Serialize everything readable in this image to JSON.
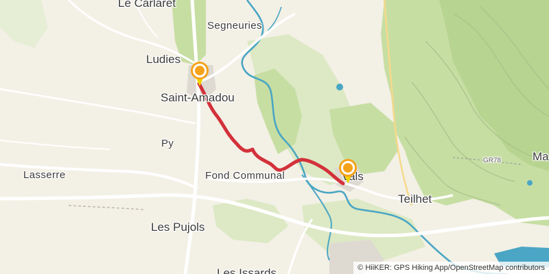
{
  "map": {
    "colors": {
      "background": "#f3f0e6",
      "forest": "#c7dea3",
      "forest_dark": "#b4d18c",
      "contour": "#a9c18a",
      "water": "#4aa6c4",
      "road": "#ffffff",
      "road_secondary": "#f6d98b",
      "route": "#d3313a",
      "urban": "#dedad2",
      "marker_fill": "#f5a21b",
      "marker_ring": "#ffffff",
      "marker_pin": "#f2d400"
    },
    "places": [
      {
        "id": "le-carlaret",
        "label": "Le Carlaret"
      },
      {
        "id": "segneuries",
        "label": "Segneuries"
      },
      {
        "id": "ludies",
        "label": "Ludies"
      },
      {
        "id": "saint-amadou",
        "label": "Saint-Amadou"
      },
      {
        "id": "py",
        "label": "Py"
      },
      {
        "id": "lasserre",
        "label": "Lasserre"
      },
      {
        "id": "fond-communal",
        "label": "Fond Communal"
      },
      {
        "id": "vals",
        "label": "Vals"
      },
      {
        "id": "teilhet",
        "label": "Teilhet"
      },
      {
        "id": "les-pujols",
        "label": "Les Pujols"
      },
      {
        "id": "les-issards",
        "label": "Les Issards"
      },
      {
        "id": "gr78",
        "label": "GR78"
      },
      {
        "id": "ma",
        "label": "Ma"
      }
    ],
    "markers": [
      {
        "id": "start",
        "icon": "map-pin-icon"
      },
      {
        "id": "end",
        "icon": "map-pin-icon"
      }
    ],
    "attribution": "© HiiKER: GPS Hiking App/OpenStreetMap contributors"
  }
}
